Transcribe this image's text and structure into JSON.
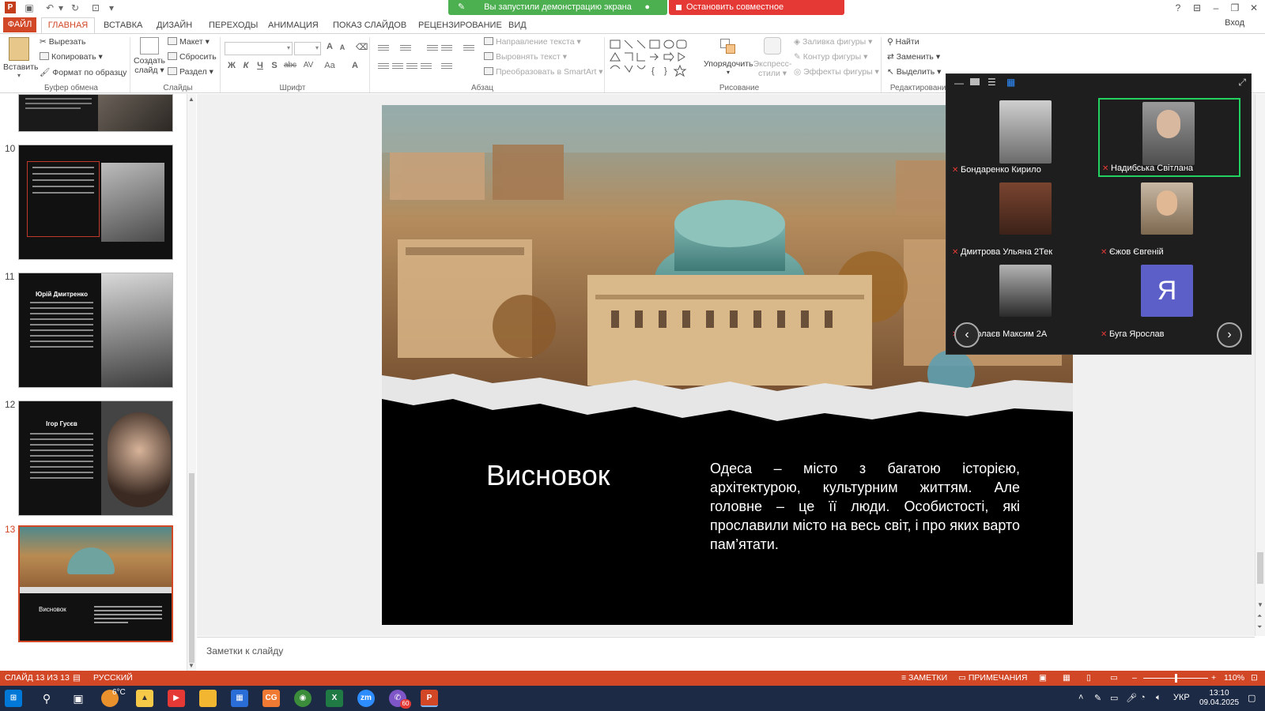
{
  "title_bar": {
    "sharing_status": "Вы запустили демонстрацию экрана",
    "stop_sharing": "Остановить совместное использование"
  },
  "tabs": [
    "ФАЙЛ",
    "ГЛАВНАЯ",
    "ВСТАВКА",
    "ДИЗАЙН",
    "ПЕРЕХОДЫ",
    "АНИМАЦИЯ",
    "ПОКАЗ СЛАЙДОВ",
    "РЕЦЕНЗИРОВАНИЕ",
    "ВИД"
  ],
  "signin": "Вход",
  "ribbon": {
    "clipboard": {
      "paste": "Вставить",
      "cut": "Вырезать",
      "copy": "Копировать",
      "format_painter": "Формат по образцу",
      "label": "Буфер обмена"
    },
    "slides": {
      "new_slide_1": "Создать",
      "new_slide_2": "слайд",
      "layout": "Макет",
      "reset": "Сбросить",
      "section": "Раздел",
      "label": "Слайды"
    },
    "font": {
      "bold": "Ж",
      "italic": "К",
      "underline": "Ч",
      "shadow": "S",
      "strike": "abc",
      "spacing": "AV",
      "case": "Aa",
      "color": "A",
      "grow": "A",
      "shrink": "A",
      "label": "Шрифт"
    },
    "paragraph": {
      "text_direction": "Направление текста",
      "align_text": "Выровнять текст",
      "smartart": "Преобразовать в SmartArt",
      "label": "Абзац"
    },
    "drawing": {
      "arrange": "Упорядочить",
      "quick_styles_1": "Экспресс-",
      "quick_styles_2": "стили",
      "shape_fill": "Заливка фигуры",
      "shape_outline": "Контур фигуры",
      "shape_effects": "Эффекты фигуры",
      "label": "Рисование"
    },
    "editing": {
      "find": "Найти",
      "replace": "Заменить",
      "select": "Выделить",
      "label": "Редактирование"
    }
  },
  "slides_pane": [
    {
      "number": "10",
      "title": ""
    },
    {
      "number": "11",
      "title": "Юрій Дмитренко"
    },
    {
      "number": "12",
      "title": "Ігор Гусєв"
    },
    {
      "number": "13",
      "title": "Висновок"
    }
  ],
  "current_slide": {
    "title": "Висновок",
    "body": "Одеса – місто з багатою історією, архітектурою, культурним життям. Але головне – це її люди. Особистості, які прославили місто на весь світ, і про яких варто пам’ятати."
  },
  "notes_placeholder": "Заметки к слайду",
  "status_bar": {
    "slide_counter": "СЛАЙД 13 ИЗ 13",
    "language": "РУССКИЙ",
    "notes": "ЗАМЕТКИ",
    "comments": "ПРИМЕЧАНИЯ",
    "zoom": "110%"
  },
  "zoom_participants": [
    {
      "name": "Бондаренко Кирило",
      "active": false
    },
    {
      "name": "Надибська Світлана",
      "active": true
    },
    {
      "name": "Дмитрова Ульяна 2Тек",
      "active": false
    },
    {
      "name": "Єжов Євгеній",
      "active": false
    },
    {
      "name": "Миколаєв Максим 2А",
      "active": false
    },
    {
      "name": "Буга Ярослав",
      "active": false,
      "initial": "Я"
    }
  ],
  "taskbar": {
    "weather": "6°C",
    "viber_badge": "60",
    "keyboard_lang": "УКР",
    "time": "13:10",
    "date": "09.04.2025"
  },
  "colors": {
    "accent": "#d24726",
    "share_green": "#4caf50",
    "share_red": "#e53935",
    "zoom_active": "#23d160",
    "avatar": "#5b5fc7"
  }
}
